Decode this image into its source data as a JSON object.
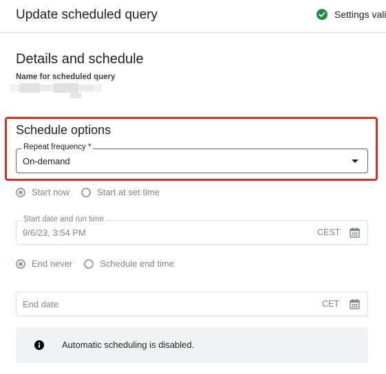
{
  "header": {
    "title": "Update scheduled query",
    "status_text": "Settings valic",
    "status_color": "#1e8e3e",
    "status_icon": "check-circle-icon"
  },
  "details": {
    "title": "Details and schedule",
    "name_label": "Name for scheduled query"
  },
  "schedule": {
    "title": "Schedule options",
    "repeat_label": "Repeat frequency *",
    "repeat_value": "On-demand",
    "start_options": [
      {
        "label": "Start now",
        "selected": true
      },
      {
        "label": "Start at set time",
        "selected": false
      }
    ],
    "start_field": {
      "label": "Start date and run time",
      "value": "9/6/23, 3:54 PM",
      "timezone": "CEST",
      "icon": "calendar-icon"
    },
    "end_options": [
      {
        "label": "End never",
        "selected": true
      },
      {
        "label": "Schedule end time",
        "selected": false
      }
    ],
    "end_field": {
      "placeholder": "End date",
      "timezone": "CET",
      "icon": "calendar-icon"
    }
  },
  "info": {
    "icon": "info-icon",
    "message": "Automatic scheduling is disabled."
  },
  "colors": {
    "highlight": "#d93025",
    "disabled_text": "#80868b"
  }
}
